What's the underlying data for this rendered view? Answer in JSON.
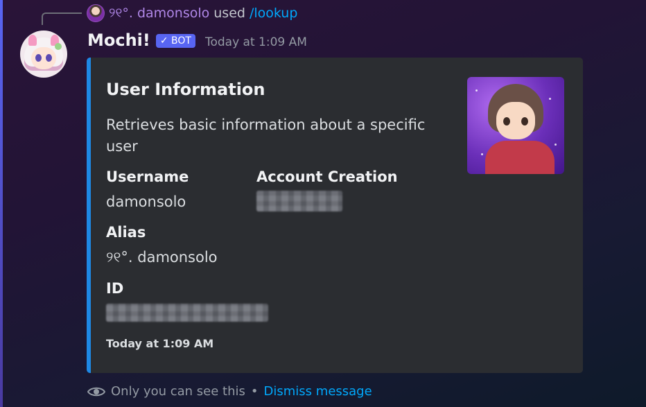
{
  "reply": {
    "author": "୨୧°. damonsolo",
    "used_text": "used",
    "command": "/lookup"
  },
  "message": {
    "author": "Mochi!",
    "bot_tag": "✓ BOT",
    "timestamp": "Today at 1:09 AM"
  },
  "embed": {
    "accent_color": "#1e88e5",
    "title": "User Information",
    "description": "Retrieves basic information about a specific user",
    "fields": [
      {
        "name": "Username",
        "value": "damonsolo"
      },
      {
        "name": "Account Creation",
        "value": ""
      },
      {
        "name": "Alias",
        "value": "୨୧°. damonsolo"
      },
      {
        "name": "ID",
        "value": ""
      }
    ],
    "footer": "Today at 1:09 AM"
  },
  "ephemeral": {
    "icon": "eye-icon",
    "notice": "Only you can see this",
    "separator": "•",
    "dismiss_label": "Dismiss message"
  }
}
